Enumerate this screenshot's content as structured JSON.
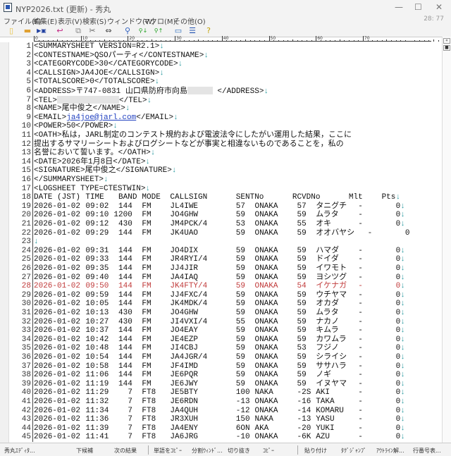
{
  "window": {
    "title": "NYP2026.txt (更新) - 秀丸",
    "minimize": "—",
    "maximize": "☐",
    "close": "✕",
    "cursor_pos": "28: 77"
  },
  "menu": [
    "ファイル(F)",
    "編集(E)",
    "表示(V)",
    "検索(S)",
    "ウィンドウ(W)",
    "マクロ(M)",
    "その他(O)"
  ],
  "toolbar": [
    {
      "icon": "new-file-icon",
      "glyph": "▯",
      "color": "#e8c040"
    },
    {
      "icon": "open-folder-icon",
      "glyph": "▬",
      "color": "#e0a030"
    },
    {
      "icon": "save-icon",
      "glyph": "▶▣",
      "color": "#2040a0"
    },
    {
      "icon": "undo-icon",
      "glyph": "↩",
      "color": "#c02080"
    },
    {
      "icon": "copy-icon",
      "glyph": "⧉",
      "color": "#888888"
    },
    {
      "icon": "cut-icon",
      "glyph": "✂",
      "color": "#666666"
    },
    {
      "icon": "paste-icon",
      "glyph": "⇔",
      "color": "#444444"
    },
    {
      "icon": "search-icon",
      "glyph": "⚲",
      "color": "#3060c0"
    },
    {
      "icon": "search-down-icon",
      "glyph": "⚲↓",
      "color": "#20a020"
    },
    {
      "icon": "search-up-icon",
      "glyph": "⚲↑",
      "color": "#20a020"
    },
    {
      "icon": "tag-jump-icon",
      "glyph": "▭",
      "color": "#3070c0"
    },
    {
      "icon": "split-window-icon",
      "glyph": "☰",
      "color": "#2050b0"
    },
    {
      "icon": "help-icon",
      "glyph": "?",
      "color": "#c0a000"
    }
  ],
  "ruler": [
    "0",
    "10",
    "20",
    "30",
    "40",
    "50",
    "60",
    "70"
  ],
  "text_lines": [
    {
      "n": "1",
      "parts": [
        {
          "t": "<SUMMARYSHEET VERSION=R2.1>"
        }
      ],
      "eol": "↓"
    },
    {
      "n": "2",
      "parts": [
        {
          "t": "<CONTESTNAME>QSOパーティ</CONTESTNAME>"
        }
      ],
      "eol": "↓"
    },
    {
      "n": "3",
      "parts": [
        {
          "t": "<CATEGORYCODE>30</CATEGORYCODE>"
        }
      ],
      "eol": "↓"
    },
    {
      "n": "4",
      "parts": [
        {
          "t": "<CALLSIGN>JA4JOE</CALLSIGN>"
        }
      ],
      "eol": "↓"
    },
    {
      "n": "5",
      "parts": [
        {
          "t": "<TOTALSCORE>0</TOTALSCORE>"
        }
      ],
      "eol": "↓"
    },
    {
      "n": "6",
      "parts": [
        {
          "t": "<ADDRESS>〒747-0831 山口県防府市向島"
        },
        {
          "redact": 36
        },
        {
          "t": " </ADDRESS>"
        }
      ],
      "eol": "↓"
    },
    {
      "n": "7",
      "parts": [
        {
          "t": "<TEL>"
        },
        {
          "redact": 88
        },
        {
          "t": "</TEL>"
        }
      ],
      "eol": "↓"
    },
    {
      "n": "8",
      "parts": [
        {
          "t": "<NAME>尾中俊之</NAME>"
        }
      ],
      "eol": "↓"
    },
    {
      "n": "9",
      "parts": [
        {
          "t": "<EMAIL>"
        },
        {
          "link": "ja4joe@jarl.com"
        },
        {
          "t": "</EMAIL>"
        }
      ],
      "eol": "↓"
    },
    {
      "n": "10",
      "parts": [
        {
          "t": "<POWER>50</POWER>"
        }
      ],
      "eol": "↓"
    },
    {
      "n": "11",
      "parts": [
        {
          "t": "<OATH>私は，JARL制定のコンテスト規約および電波法令にしたがい運用した結果，ここに"
        }
      ],
      "eol": ""
    },
    {
      "n": "12",
      "parts": [
        {
          "t": "提出するサマリーシートおよびログシートなどが事実と相違ないものであることを，私の"
        }
      ],
      "eol": ""
    },
    {
      "n": "13",
      "parts": [
        {
          "t": "名誉において誓います。</OATH>"
        }
      ],
      "eol": "↓"
    },
    {
      "n": "14",
      "parts": [
        {
          "t": "<DATE>2026年1月8日</DATE>"
        }
      ],
      "eol": "↓"
    },
    {
      "n": "15",
      "parts": [
        {
          "t": "<SIGNATURE>尾中俊之</SIGNATURE>"
        }
      ],
      "eol": "↓"
    },
    {
      "n": "16",
      "parts": [
        {
          "t": "</SUMMARYSHEET>"
        }
      ],
      "eol": "↓"
    },
    {
      "n": "17",
      "parts": [
        {
          "t": "<LOGSHEET TYPE=CTESTWIN>"
        }
      ],
      "eol": "↓"
    }
  ],
  "log_header": {
    "n": "18",
    "cols": [
      "DATE (JST)",
      "TIME",
      "BAND",
      "MODE",
      "CALLSIGN",
      "SENTNo",
      "RCVDNo",
      "Mlt",
      "Pts"
    ],
    "eol": "↓"
  },
  "log_rows": [
    {
      "n": "19",
      "date": "2026-01-02",
      "time": "09:02",
      "band": "144",
      "mode": "FM",
      "call": "JL4IWE",
      "sent": "57",
      "sqth": "ONAKA",
      "rcvd": "57",
      "rname": "タニグチ",
      "mlt": "-",
      "pts": "0",
      "eol": "↓"
    },
    {
      "n": "20",
      "date": "2026-01-02",
      "time": "09:10",
      "band": "1200",
      "mode": "FM",
      "call": "JO4GHW",
      "sent": "59",
      "sqth": "ONAKA",
      "rcvd": "59",
      "rname": "ムラタ",
      "mlt": "-",
      "pts": "0",
      "eol": "↓"
    },
    {
      "n": "21",
      "date": "2026-01-02",
      "time": "09:12",
      "band": "430",
      "mode": "FM",
      "call": "JM4PCK/4",
      "sent": "53",
      "sqth": "ONAKA",
      "rcvd": "55",
      "rname": "オキ",
      "mlt": "-",
      "pts": "0",
      "eol": "↓"
    },
    {
      "n": "22",
      "date": "2026-01-02",
      "time": "09:29",
      "band": "144",
      "mode": "FM",
      "call": "JK4UAO",
      "sent": "59",
      "sqth": "ONAKA",
      "rcvd": "59",
      "rname": "オオバヤシ",
      "mlt": "-",
      "pts": "0",
      "eol": ""
    },
    {
      "n": "23",
      "blank": true,
      "eol": "↓"
    },
    {
      "n": "24",
      "date": "2026-01-02",
      "time": "09:31",
      "band": "144",
      "mode": "FM",
      "call": "JO4DIX",
      "sent": "59",
      "sqth": "ONAKA",
      "rcvd": "59",
      "rname": "ハマダ",
      "mlt": "-",
      "pts": "0",
      "eol": "↓"
    },
    {
      "n": "25",
      "date": "2026-01-02",
      "time": "09:33",
      "band": "144",
      "mode": "FM",
      "call": "JR4RYI/4",
      "sent": "59",
      "sqth": "ONAKA",
      "rcvd": "59",
      "rname": "ドイダ",
      "mlt": "-",
      "pts": "0",
      "eol": "↓"
    },
    {
      "n": "26",
      "date": "2026-01-02",
      "time": "09:35",
      "band": "144",
      "mode": "FM",
      "call": "JJ4JIR",
      "sent": "59",
      "sqth": "ONAKA",
      "rcvd": "59",
      "rname": "イワモト",
      "mlt": "-",
      "pts": "0",
      "eol": "↓"
    },
    {
      "n": "27",
      "date": "2026-01-02",
      "time": "09:40",
      "band": "144",
      "mode": "FM",
      "call": "JA4IAQ",
      "sent": "59",
      "sqth": "ONAKA",
      "rcvd": "59",
      "rname": "ヨシツグ",
      "mlt": "-",
      "pts": "0",
      "eol": "↓"
    },
    {
      "n": "28",
      "date": "2026-01-02",
      "time": "09:50",
      "band": "144",
      "mode": "FM",
      "call": "JK4FTY/4",
      "sent": "59",
      "sqth": "ONAKA",
      "rcvd": "54",
      "rname": "イケナガ",
      "mlt": "-",
      "pts": "0",
      "eol": "↓",
      "current": true
    },
    {
      "n": "29",
      "date": "2026-01-02",
      "time": "09:59",
      "band": "144",
      "mode": "FM",
      "call": "JJ4FXC/4",
      "sent": "59",
      "sqth": "ONAKA",
      "rcvd": "59",
      "rname": "ウチヤマ",
      "mlt": "-",
      "pts": "0",
      "eol": "↓"
    },
    {
      "n": "30",
      "date": "2026-01-02",
      "time": "10:05",
      "band": "144",
      "mode": "FM",
      "call": "JK4MDK/4",
      "sent": "59",
      "sqth": "ONAKA",
      "rcvd": "59",
      "rname": "オカダ",
      "mlt": "-",
      "pts": "0",
      "eol": "↓"
    },
    {
      "n": "31",
      "date": "2026-01-02",
      "time": "10:13",
      "band": "430",
      "mode": "FM",
      "call": "JO4GHW",
      "sent": "59",
      "sqth": "ONAKA",
      "rcvd": "59",
      "rname": "ムラタ",
      "mlt": "-",
      "pts": "0",
      "eol": "↓"
    },
    {
      "n": "32",
      "date": "2026-01-02",
      "time": "10:27",
      "band": "430",
      "mode": "FM",
      "call": "JI4VXI/4",
      "sent": "55",
      "sqth": "ONAKA",
      "rcvd": "59",
      "rname": "ナカノ",
      "mlt": "-",
      "pts": "0",
      "eol": "↓"
    },
    {
      "n": "33",
      "date": "2026-01-02",
      "time": "10:37",
      "band": "144",
      "mode": "FM",
      "call": "JO4EAY",
      "sent": "59",
      "sqth": "ONAKA",
      "rcvd": "59",
      "rname": "キムラ",
      "mlt": "-",
      "pts": "0",
      "eol": "↓"
    },
    {
      "n": "34",
      "date": "2026-01-02",
      "time": "10:42",
      "band": "144",
      "mode": "FM",
      "call": "JE4EZP",
      "sent": "59",
      "sqth": "ONAKA",
      "rcvd": "59",
      "rname": "カワムラ",
      "mlt": "-",
      "pts": "0",
      "eol": "↓"
    },
    {
      "n": "35",
      "date": "2026-01-02",
      "time": "10:48",
      "band": "144",
      "mode": "FM",
      "call": "JI4CBJ",
      "sent": "59",
      "sqth": "ONAKA",
      "rcvd": "53",
      "rname": "フジノ",
      "mlt": "-",
      "pts": "0",
      "eol": "↓"
    },
    {
      "n": "36",
      "date": "2026-01-02",
      "time": "10:54",
      "band": "144",
      "mode": "FM",
      "call": "JA4JGR/4",
      "sent": "59",
      "sqth": "ONAKA",
      "rcvd": "59",
      "rname": "シライシ",
      "mlt": "-",
      "pts": "0",
      "eol": "↓"
    },
    {
      "n": "37",
      "date": "2026-01-02",
      "time": "10:58",
      "band": "144",
      "mode": "FM",
      "call": "JF4IMD",
      "sent": "59",
      "sqth": "ONAKA",
      "rcvd": "59",
      "rname": "ササハラ",
      "mlt": "-",
      "pts": "0",
      "eol": "↓"
    },
    {
      "n": "38",
      "date": "2026-01-02",
      "time": "11:06",
      "band": "144",
      "mode": "FM",
      "call": "JE6PQR",
      "sent": "59",
      "sqth": "ONAKA",
      "rcvd": "59",
      "rname": "ノギ",
      "mlt": "-",
      "pts": "0",
      "eol": "↓"
    },
    {
      "n": "39",
      "date": "2026-01-02",
      "time": "11:19",
      "band": "144",
      "mode": "FM",
      "call": "JE6JWY",
      "sent": "59",
      "sqth": "ONAKA",
      "rcvd": "59",
      "rname": "イヌヤマ",
      "mlt": "-",
      "pts": "0",
      "eol": "↓"
    },
    {
      "n": "40",
      "date": "2026-01-02",
      "time": "11:29",
      "band": "7",
      "mode": "FT8",
      "call": "JE5BTY",
      "sent": "100",
      "sqth": "NAKA",
      "rcvd": "-2S",
      "rname": "AKI",
      "mlt": "-",
      "pts": "0",
      "eol": "↓"
    },
    {
      "n": "41",
      "date": "2026-01-02",
      "time": "11:32",
      "band": "7",
      "mode": "FT8",
      "call": "JE6RDN",
      "sent": "-13",
      "sqth": "ONAKA",
      "rcvd": "-16",
      "rname": "TAKA",
      "mlt": "-",
      "pts": "0",
      "eol": "↓"
    },
    {
      "n": "42",
      "date": "2026-01-02",
      "time": "11:34",
      "band": "7",
      "mode": "FT8",
      "call": "JA4QUH",
      "sent": "-12",
      "sqth": "ONAKA",
      "rcvd": "-14",
      "rname": "KOMARU",
      "mlt": "-",
      "pts": "0",
      "eol": "↓"
    },
    {
      "n": "43",
      "date": "2026-01-02",
      "time": "11:36",
      "band": "7",
      "mode": "FT8",
      "call": "JR3XUH",
      "sent": "150",
      "sqth": "NAKA",
      "rcvd": "-13",
      "rname": "YASU",
      "mlt": "-",
      "pts": "0",
      "eol": "↓"
    },
    {
      "n": "44",
      "date": "2026-01-02",
      "time": "11:39",
      "band": "7",
      "mode": "FT8",
      "call": "JA4ENY",
      "sent": "6ON",
      "sqth": "AKA",
      "rcvd": "-20",
      "rname": "YUKI",
      "mlt": "-",
      "pts": "0",
      "eol": "↓"
    },
    {
      "n": "45",
      "date": "2026-01-02",
      "time": "11:41",
      "band": "7",
      "mode": "FT8",
      "call": "JA6JRG",
      "sent": "-10",
      "sqth": "ONAKA",
      "rcvd": "-6K",
      "rname": "AZU",
      "mlt": "-",
      "pts": "0",
      "eol": "↓"
    }
  ],
  "status_bar": [
    "秀丸ｴﾃﾞｨﾀ...",
    "下候補",
    "次の結果",
    "単語をｺﾋﾟｰ",
    "分割ｳｨﾝﾄﾞ...",
    "切り抜き",
    "ｺﾋﾟｰ",
    "貼り付け",
    "ﾀｸﾞｼﾞｬﾝﾌﾟ",
    "ｱｳﾄﾗｲﾝ解...",
    "行番号表..."
  ],
  "colors": {
    "eol": "#2a9aa0",
    "current_line": "#c03a3a",
    "link": "#2040c0"
  }
}
